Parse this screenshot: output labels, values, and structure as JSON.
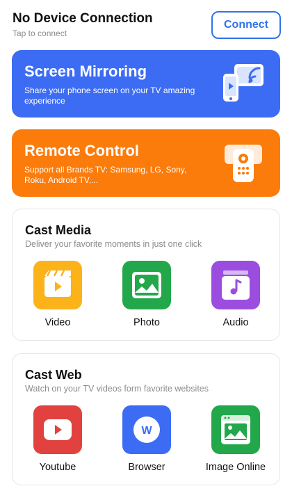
{
  "connection": {
    "title": "No Device Connection",
    "subtitle": "Tap to connect",
    "button_label": "Connect"
  },
  "features": [
    {
      "title": "Screen Mirroring",
      "description": "Share your phone screen on your TV amazing experience",
      "icon": "screen-mirroring-icon",
      "color": "#3d6cf4"
    },
    {
      "title": "Remote Control",
      "description": "Support all Brands TV: Samsung, LG, Sony, Roku, Android TV,...",
      "icon": "remote-control-icon",
      "color": "#fb7b0b"
    }
  ],
  "cast_media": {
    "title": "Cast Media",
    "subtitle": "Deliver your favorite moments in just one click",
    "items": [
      {
        "label": "Video",
        "icon": "video-icon",
        "color": "#fbb319"
      },
      {
        "label": "Photo",
        "icon": "photo-icon",
        "color": "#22a84a"
      },
      {
        "label": "Audio",
        "icon": "audio-icon",
        "color": "#9b4de0"
      }
    ]
  },
  "cast_web": {
    "title": "Cast Web",
    "subtitle": "Watch on your TV videos form favorite websites",
    "items": [
      {
        "label": "Youtube",
        "icon": "youtube-icon",
        "color": "#e2423f"
      },
      {
        "label": "Browser",
        "icon": "browser-icon",
        "color": "#3d6cf4"
      },
      {
        "label": "Image Online",
        "icon": "image-online-icon",
        "color": "#22a84a"
      }
    ]
  }
}
